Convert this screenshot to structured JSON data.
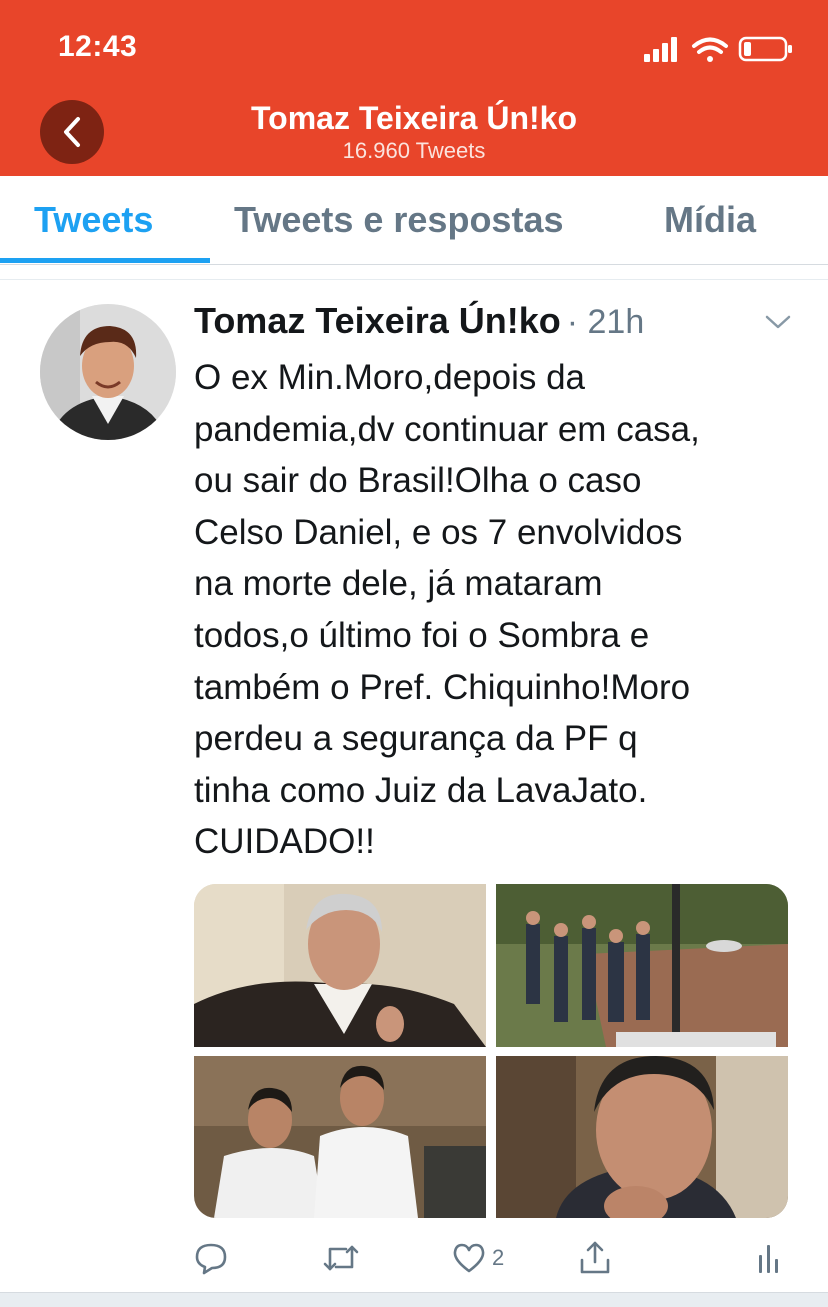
{
  "status_bar": {
    "time": "12:43"
  },
  "header": {
    "title": "Tomaz Teixeira Ún!ko",
    "subtitle": "16.960 Tweets",
    "back_icon": "chevron-left-icon"
  },
  "tabs": [
    {
      "label": "Tweets",
      "active": true
    },
    {
      "label": "Tweets e respostas",
      "active": false
    },
    {
      "label": "Mídia",
      "active": false
    }
  ],
  "tweet": {
    "author": "Tomaz Teixeira Ún!ko",
    "time": "· 21h",
    "text": "O ex Min.Moro,depois da\npandemia,dv continuar em casa,\nou sair do Brasil!Olha o caso\nCelso Daniel, e os 7 envolvidos\nna morte dele, já mataram\ntodos,o último foi o Sombra e\ntambém o Pref. Chiquinho!Moro\nperdeu a segurança da PF q\ntinha como Juiz da LavaJato.\nCUIDADO!!",
    "likes": "2",
    "media_count": 4
  },
  "colors": {
    "header_bg": "#e8452a",
    "accent": "#1da1f2",
    "muted": "#657786"
  },
  "icons": [
    "reply-icon",
    "retweet-icon",
    "heart-icon",
    "share-icon",
    "analytics-icon",
    "caret-down-icon"
  ]
}
